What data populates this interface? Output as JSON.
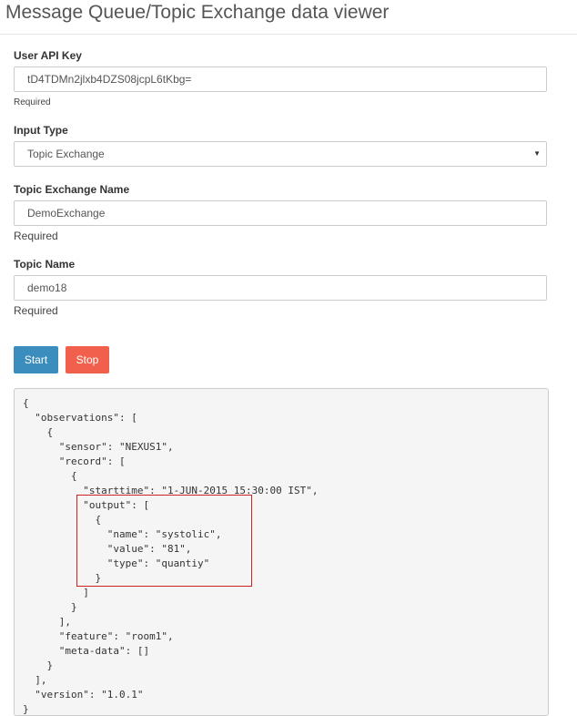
{
  "page": {
    "title": "Message Queue/Topic Exchange data viewer"
  },
  "form": {
    "api_key": {
      "label": "User API Key",
      "value": "tD4TDMn2jlxb4DZS08jcpL6tKbg=",
      "help": "Required"
    },
    "input_type": {
      "label": "Input Type",
      "selected": "Topic Exchange"
    },
    "exchange_name": {
      "label": "Topic Exchange Name",
      "value": "DemoExchange",
      "help": "Required"
    },
    "topic_name": {
      "label": "Topic Name",
      "value": "demo18",
      "help": "Required"
    }
  },
  "buttons": {
    "start": "Start",
    "stop": "Stop"
  },
  "output": {
    "text": "{\n  \"observations\": [\n    {\n      \"sensor\": \"NEXUS1\",\n      \"record\": [\n        {\n          \"starttime\": \"1-JUN-2015 15:30:00 IST\",\n          \"output\": [\n            {\n              \"name\": \"systolic\",\n              \"value\": \"81\",\n              \"type\": \"quantiy\"\n            }\n          ]\n        }\n      ],\n      \"feature\": \"room1\",\n      \"meta-data\": []\n    }\n  ],\n  \"version\": \"1.0.1\"\n}"
  },
  "colors": {
    "start": "#3b8dbd",
    "stop": "#f0604c",
    "highlight": "#cc2222"
  }
}
